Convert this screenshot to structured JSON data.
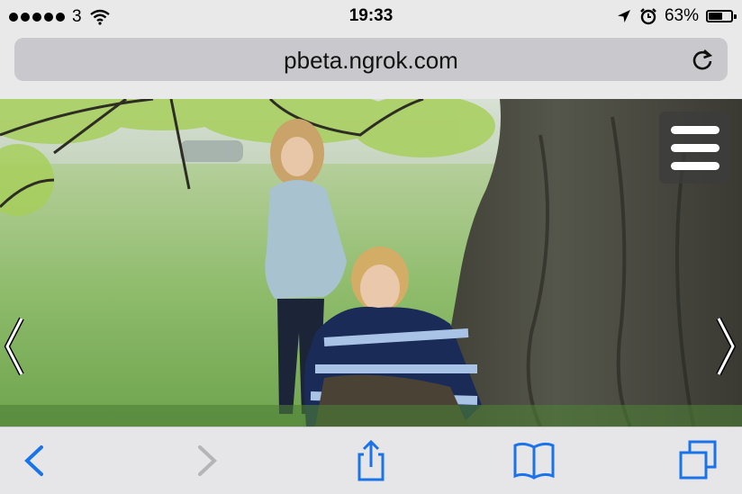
{
  "status": {
    "carrier": "3",
    "time": "19:33",
    "battery": "63%",
    "battery_level": 0.63
  },
  "browser": {
    "url": "pbeta.ngrok.com"
  },
  "colors": {
    "accent": "#1a73e8",
    "disabled": "#b5b5b5",
    "status_bg": "#e9e9ea",
    "urlfield_bg": "#c9c9cd"
  },
  "icons": {
    "signal": "signal-dots-icon",
    "wifi": "wifi-icon",
    "location": "location-arrow-icon",
    "alarm": "alarm-clock-icon",
    "battery": "battery-icon",
    "reload": "reload-icon",
    "menu": "hamburger-menu-icon",
    "prev": "chevron-left-icon",
    "next": "chevron-right-icon",
    "back": "back-icon",
    "forward": "forward-icon",
    "share": "share-icon",
    "bookmarks": "book-icon",
    "tabs": "tabs-icon"
  }
}
